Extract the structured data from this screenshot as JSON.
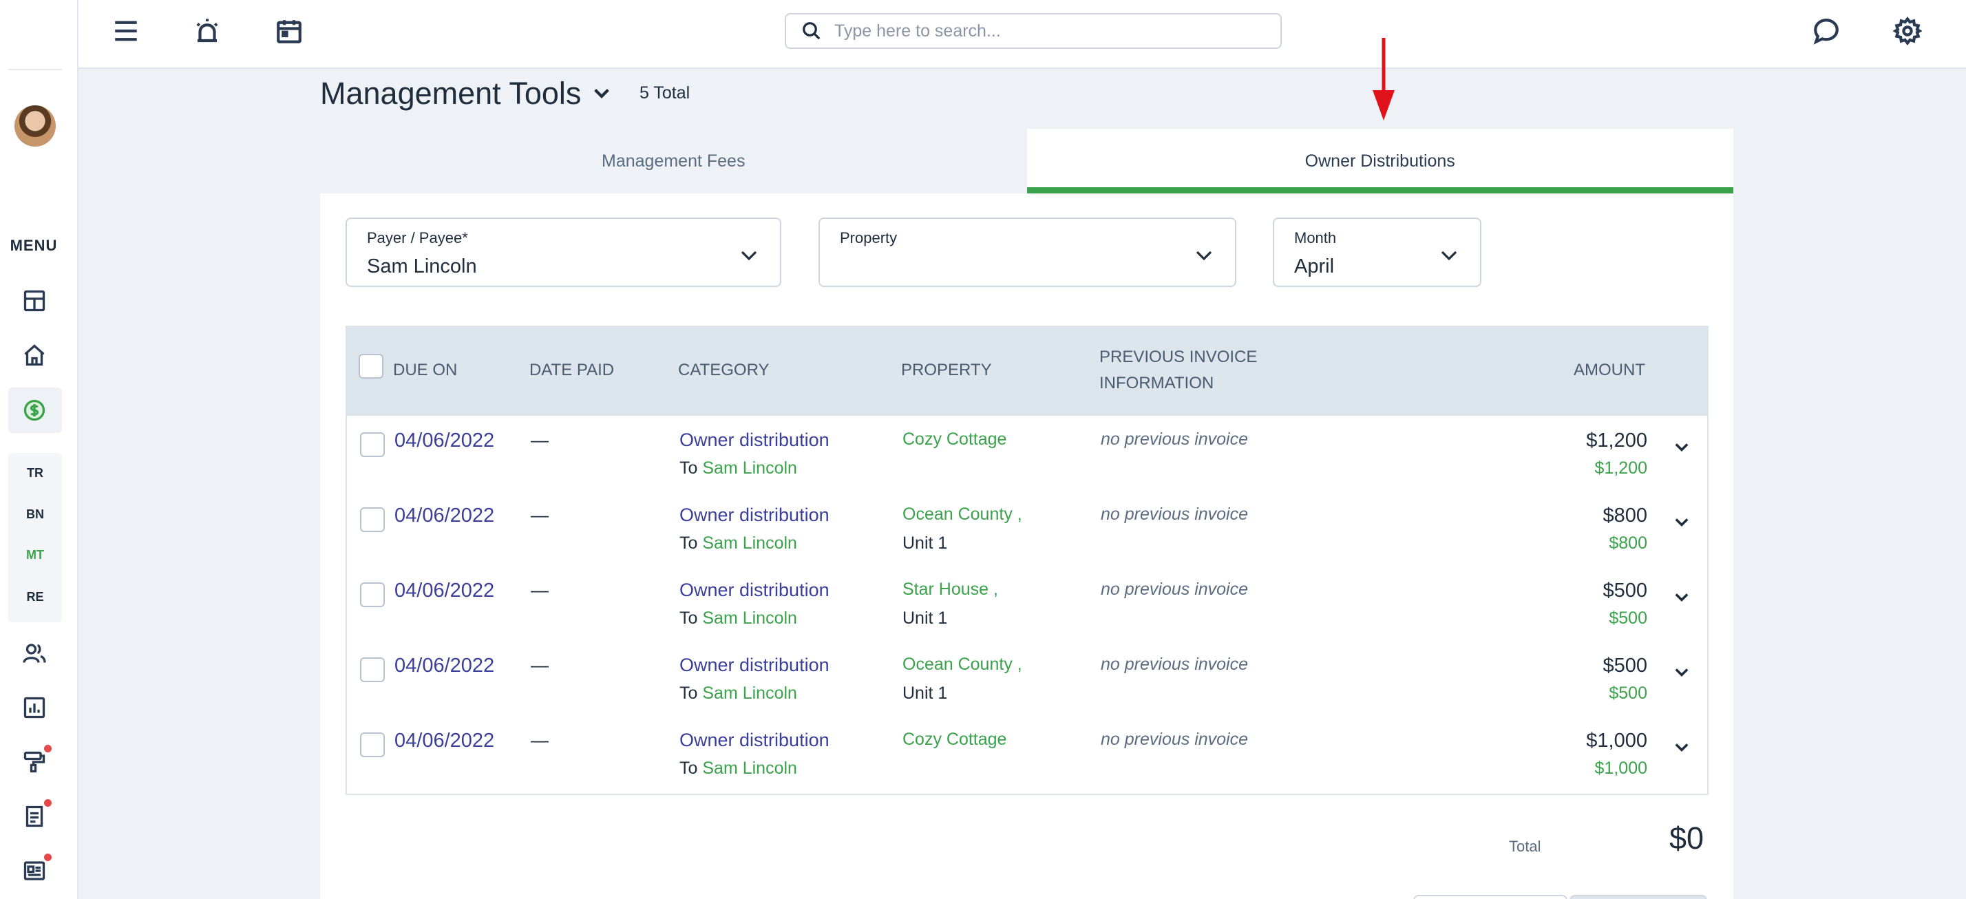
{
  "sidebar": {
    "menu_label": "MENU",
    "sub_items": [
      "TR",
      "BN",
      "MT",
      "RE"
    ],
    "active_sub": "MT"
  },
  "topbar": {
    "search_placeholder": "Type here to search..."
  },
  "header": {
    "title": "Management Tools",
    "total": "5 Total"
  },
  "tabs": [
    {
      "label": "Management Fees",
      "active": false
    },
    {
      "label": "Owner Distributions",
      "active": true
    }
  ],
  "filters": {
    "payer": {
      "label": "Payer / Payee*",
      "value": "Sam Lincoln"
    },
    "property": {
      "label": "Property",
      "value": ""
    },
    "month": {
      "label": "Month",
      "value": "April"
    }
  },
  "table": {
    "columns": {
      "due_on": "DUE ON",
      "date_paid": "DATE PAID",
      "category": "CATEGORY",
      "property": "PROPERTY",
      "prev_line1": "PREVIOUS INVOICE",
      "prev_line2": "INFORMATION",
      "amount": "AMOUNT"
    },
    "rows": [
      {
        "due": "04/06/2022",
        "paid": "—",
        "category": "Owner distribution",
        "to_prefix": "To",
        "to_name": "Sam Lincoln",
        "property": "Cozy Cottage",
        "unit": "",
        "prev": "no previous invoice",
        "amount": "$1,200",
        "amount_sub": "$1,200"
      },
      {
        "due": "04/06/2022",
        "paid": "—",
        "category": "Owner distribution",
        "to_prefix": "To",
        "to_name": "Sam Lincoln",
        "property": "Ocean County ,",
        "unit": "Unit 1",
        "prev": "no previous invoice",
        "amount": "$800",
        "amount_sub": "$800"
      },
      {
        "due": "04/06/2022",
        "paid": "—",
        "category": "Owner distribution",
        "to_prefix": "To",
        "to_name": "Sam Lincoln",
        "property": "Star House ,",
        "unit": "Unit 1",
        "prev": "no previous invoice",
        "amount": "$500",
        "amount_sub": "$500"
      },
      {
        "due": "04/06/2022",
        "paid": "—",
        "category": "Owner distribution",
        "to_prefix": "To",
        "to_name": "Sam Lincoln",
        "property": "Ocean County ,",
        "unit": "Unit 1",
        "prev": "no previous invoice",
        "amount": "$500",
        "amount_sub": "$500"
      },
      {
        "due": "04/06/2022",
        "paid": "—",
        "category": "Owner distribution",
        "to_prefix": "To",
        "to_name": "Sam Lincoln",
        "property": "Cozy Cottage",
        "unit": "",
        "prev": "no previous invoice",
        "amount": "$1,000",
        "amount_sub": "$1,000"
      }
    ]
  },
  "footer": {
    "total_label": "Total",
    "total_value": "$0"
  },
  "colors": {
    "accent_green": "#3aa24a",
    "link_blue": "#3b3f9a",
    "arrow_red": "#e0131b"
  }
}
